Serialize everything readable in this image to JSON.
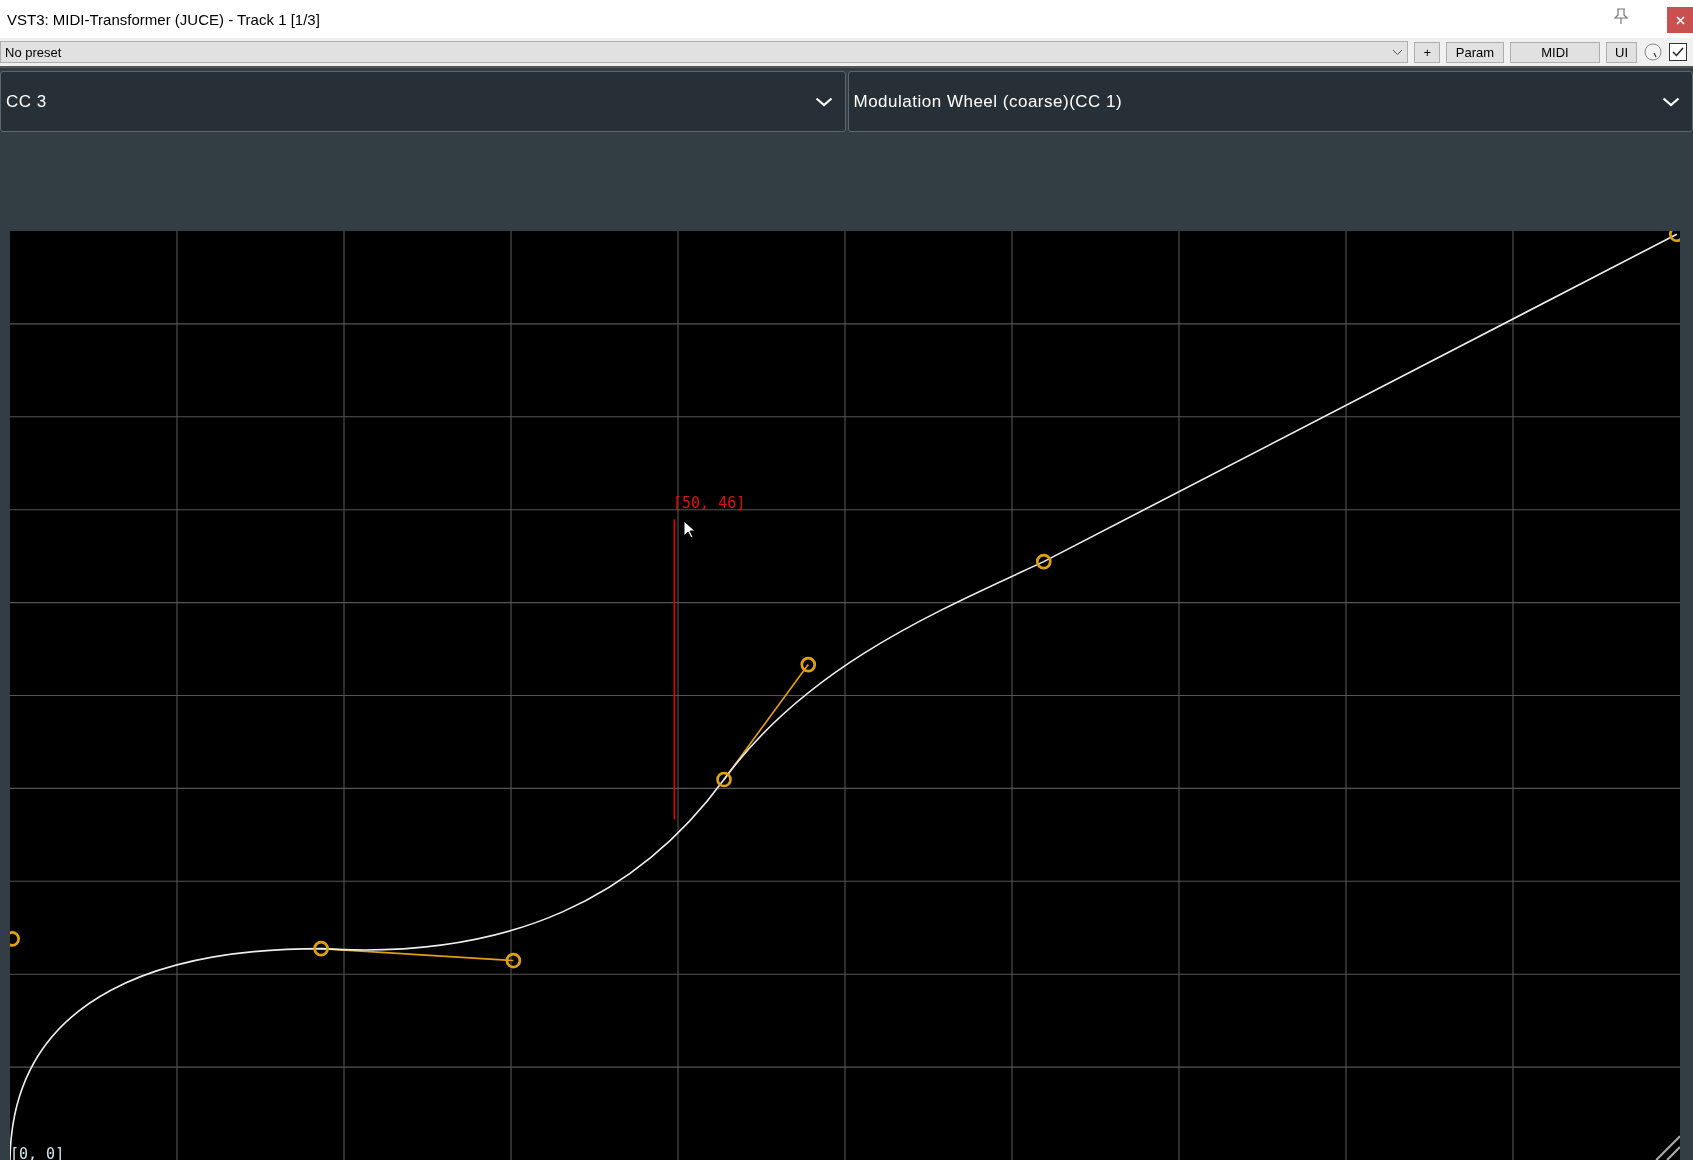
{
  "window": {
    "title": "VST3: MIDI-Transformer (JUCE) - Track 1 [1/3]"
  },
  "toolbar": {
    "preset": "No preset",
    "buttons": [
      "+",
      "Param",
      "MIDI",
      "UI"
    ],
    "bypass_checked": true
  },
  "selectors": [
    {
      "value": "CC 3"
    },
    {
      "value": "Modulation Wheel (coarse)(CC 1)"
    }
  ],
  "graph": {
    "cursor_label": "[50, 46]",
    "origin_label": "[0, 0]"
  }
}
